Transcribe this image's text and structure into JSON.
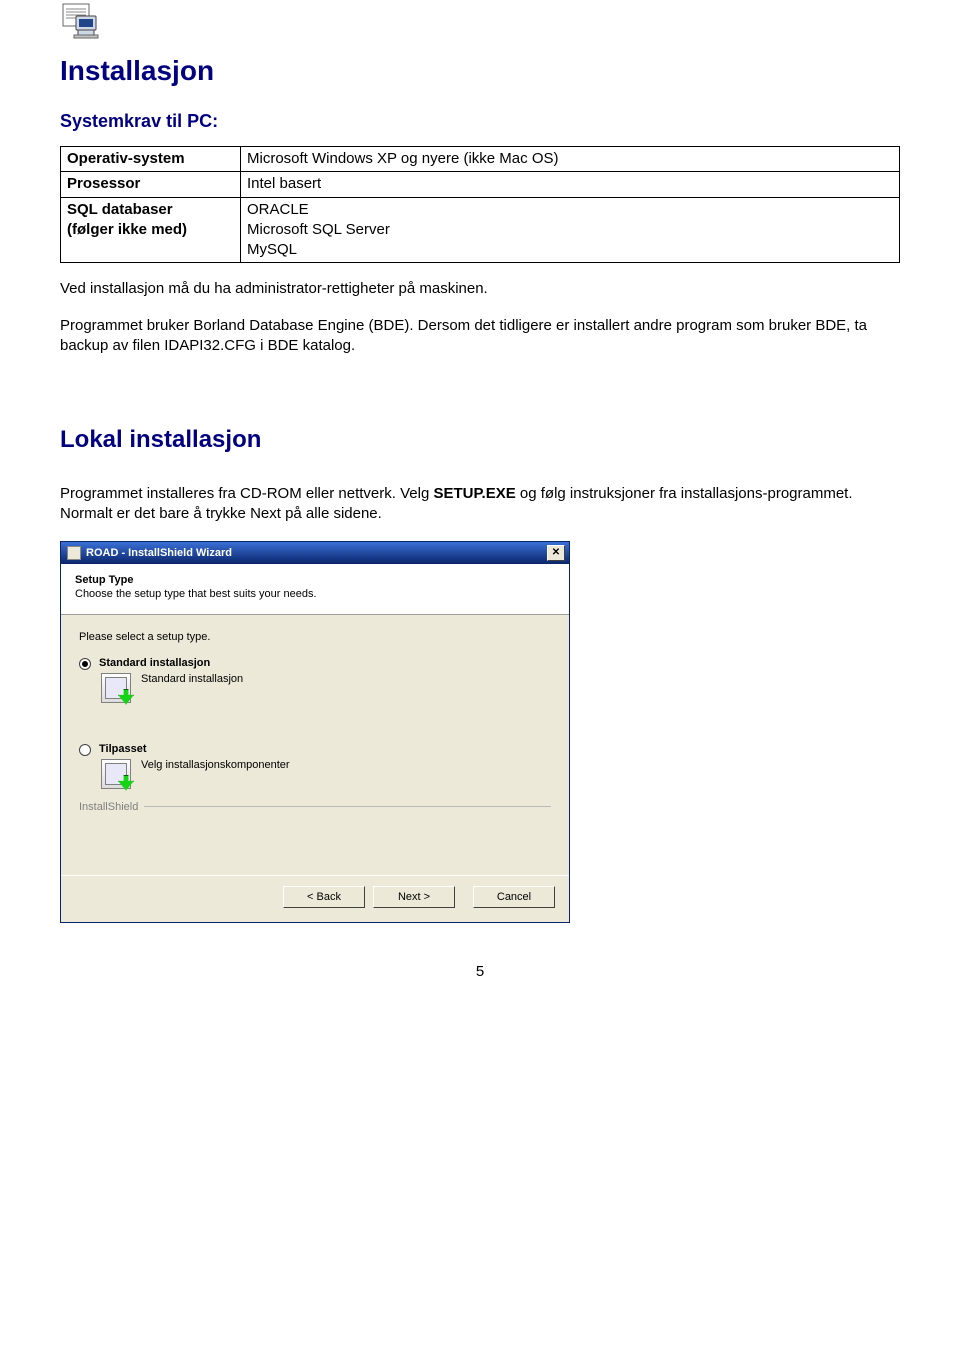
{
  "heading1": "Installasjon",
  "subheading_systemreq": "Systemkrav til PC:",
  "table": {
    "rows": [
      {
        "label": "Operativ-system",
        "value": "Microsoft Windows XP og nyere  (ikke Mac OS)"
      },
      {
        "label": "Prosessor",
        "value": "Intel basert"
      },
      {
        "label": "SQL databaser\n(følger ikke med)",
        "value": "ORACLE\nMicrosoft SQL Server\nMySQL"
      }
    ]
  },
  "para_admin": "Ved installasjon må du ha administrator-rettigheter på maskinen.",
  "para_bde": "Programmet bruker Borland Database Engine (BDE). Dersom det tidligere er installert andre program som bruker BDE, ta backup av filen IDAPI32.CFG i BDE katalog.",
  "heading2": "Lokal installasjon",
  "para_local_pre": "Programmet installeres fra CD-ROM eller nettverk. Velg ",
  "setup_exe": "SETUP.EXE",
  "para_local_post": "  og følg instruksjoner fra installasjons-programmet. Normalt er det bare å trykke Next på alle sidene.",
  "wizard": {
    "title": "ROAD - InstallShield Wizard",
    "header_title": "Setup Type",
    "header_sub": "Choose the setup type that best suits your needs.",
    "prompt": "Please select a setup type.",
    "option1": {
      "title": "Standard installasjon",
      "desc": "Standard installasjon"
    },
    "option2": {
      "title": "Tilpasset",
      "desc": "Velg installasjonskomponenter"
    },
    "brand": "InstallShield",
    "btn_back": "< Back",
    "btn_next": "Next >",
    "btn_cancel": "Cancel"
  },
  "page_number": "5"
}
